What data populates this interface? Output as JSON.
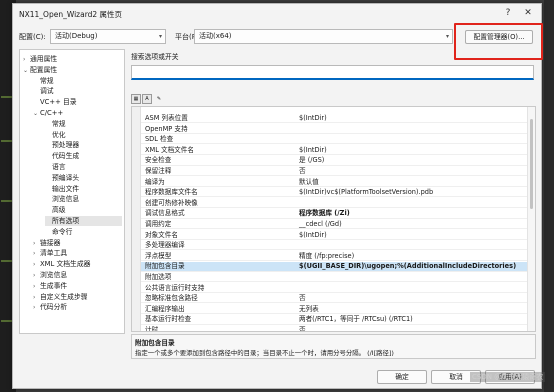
{
  "dialog": {
    "title": "NX11_Open_Wizard2 属性页",
    "help_button": "?",
    "close_button": "✕"
  },
  "config": {
    "config_label": "配置(C):",
    "config_value": "活动(Debug)",
    "platform_label": "平台(P):",
    "platform_value": "活动(x64)",
    "manager_button": "配置管理器(O)..."
  },
  "search": {
    "label": "搜索选项或开关",
    "placeholder": ""
  },
  "tree": [
    {
      "label": "通用属性",
      "expander": "›"
    },
    {
      "label": "配置属性",
      "expander": "⌄"
    },
    {
      "label": "常规",
      "expander": ""
    },
    {
      "label": "调试",
      "expander": ""
    },
    {
      "label": "VC++ 目录",
      "expander": ""
    },
    {
      "label": "C/C++",
      "expander": "⌄"
    },
    {
      "label": "常规",
      "expander": ""
    },
    {
      "label": "优化",
      "expander": ""
    },
    {
      "label": "预处理器",
      "expander": ""
    },
    {
      "label": "代码生成",
      "expander": ""
    },
    {
      "label": "语言",
      "expander": ""
    },
    {
      "label": "预编译头",
      "expander": ""
    },
    {
      "label": "输出文件",
      "expander": ""
    },
    {
      "label": "浏览信息",
      "expander": ""
    },
    {
      "label": "高级",
      "expander": ""
    },
    {
      "label": "所有选项",
      "expander": ""
    },
    {
      "label": "命令行",
      "expander": ""
    },
    {
      "label": "链接器",
      "expander": "›"
    },
    {
      "label": "清单工具",
      "expander": "›"
    },
    {
      "label": "XML 文档生成器",
      "expander": "›"
    },
    {
      "label": "浏览信息",
      "expander": "›"
    },
    {
      "label": "生成事件",
      "expander": "›"
    },
    {
      "label": "自定义生成步骤",
      "expander": "›"
    },
    {
      "label": "代码分析",
      "expander": "›"
    }
  ],
  "grid_rows": [
    {
      "name": "ASM 列表位置",
      "value": "$(IntDir)"
    },
    {
      "name": "OpenMP 支持",
      "value": ""
    },
    {
      "name": "SDL 检查",
      "value": ""
    },
    {
      "name": "XML 文档文件名",
      "value": "$(IntDir)"
    },
    {
      "name": "安全检查",
      "value": "是 (/GS)"
    },
    {
      "name": "保留注释",
      "value": "否"
    },
    {
      "name": "编译为",
      "value": "默认值"
    },
    {
      "name": "程序数据库文件名",
      "value": "$(IntDir)vc$(PlatformToolsetVersion).pdb"
    },
    {
      "name": "创建可热修补映像",
      "value": ""
    },
    {
      "name": "调试信息格式",
      "value": "程序数据库 (/Zi)"
    },
    {
      "name": "调用约定",
      "value": "__cdecl (/Gd)"
    },
    {
      "name": "对象文件名",
      "value": "$(IntDir)"
    },
    {
      "name": "多处理器编译",
      "value": ""
    },
    {
      "name": "浮点模型",
      "value": "精度 (/fp:precise)"
    },
    {
      "name": "附加包含目录",
      "value": "$(UGII_BASE_DIR)\\ugopen;%(AdditionalIncludeDirectories)"
    },
    {
      "name": "附加选项",
      "value": ""
    },
    {
      "name": "公共语言运行时支持",
      "value": ""
    },
    {
      "name": "忽略标准包含路径",
      "value": "否"
    },
    {
      "name": "汇编程序输出",
      "value": "无列表"
    },
    {
      "name": "基本运行时检查",
      "value": "两者(/RTC1，等同于 /RTCsu) (/RTC1)"
    },
    {
      "name": "计时",
      "value": "否"
    }
  ],
  "description": {
    "title": "附加包含目录",
    "text": "指定一个或多个要添加到包含路径中的目录；当目录不止一个时，请用分号分隔。    (/I[路径])"
  },
  "buttons": {
    "ok": "确定",
    "cancel": "取消",
    "apply": "应用(A)"
  },
  "watermark": "CSDN @广东大猿奇农"
}
